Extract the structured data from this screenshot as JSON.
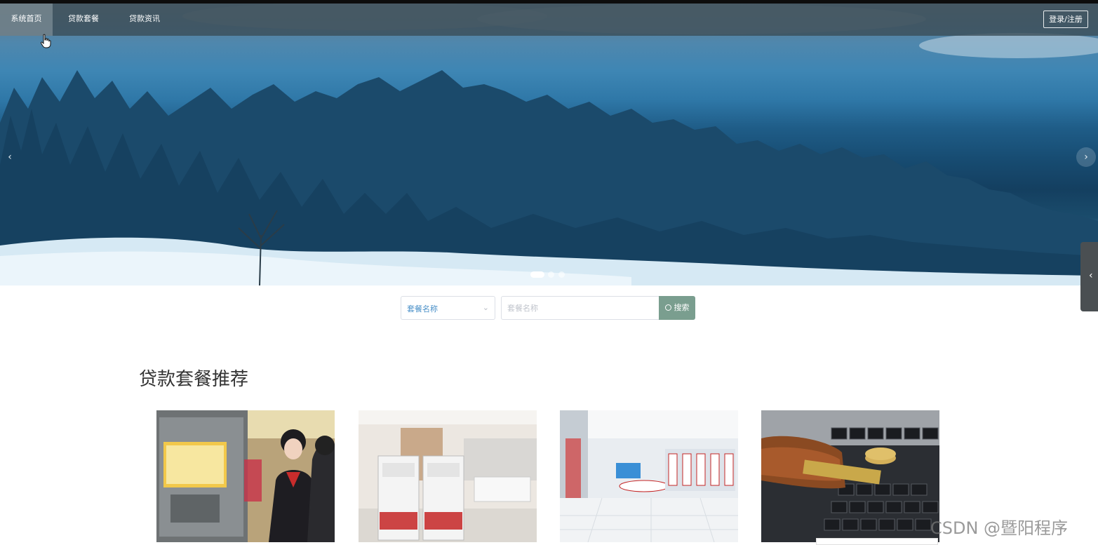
{
  "nav": {
    "items": [
      {
        "label": "系统首页"
      },
      {
        "label": "贷款套餐"
      },
      {
        "label": "贷款资讯"
      }
    ],
    "login_label": "登录/注册"
  },
  "carousel": {
    "prev_glyph": "‹",
    "next_glyph": "›",
    "slide_count": 3,
    "active_index": 0
  },
  "side_tab": {
    "glyph": "‹"
  },
  "search": {
    "select_value": "套餐名称",
    "input_placeholder": "套餐名称",
    "button_label": "搜索"
  },
  "section": {
    "title": "贷款套餐推荐"
  },
  "cards": [
    {
      "image": "bank-staff-kiosk-photo"
    },
    {
      "image": "bank-atm-lobby-photo"
    },
    {
      "image": "bank-hall-photo"
    },
    {
      "image": "wallet-keyboard-photo"
    }
  ],
  "watermark": {
    "text": "CSDN @暨阳程序"
  },
  "colors": {
    "nav_bg": "#3a4c56",
    "search_button": "#7a9e8f",
    "select_text": "#4a90c8",
    "title_text": "#333333"
  }
}
